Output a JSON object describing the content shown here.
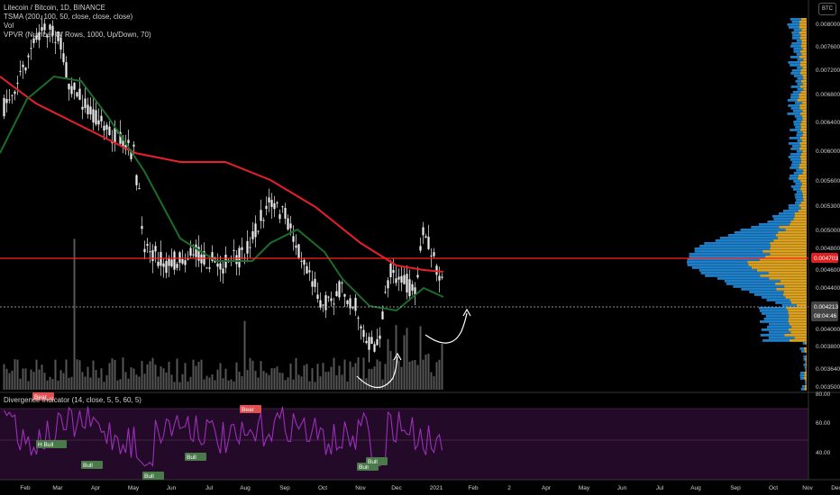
{
  "legend": {
    "title": "Litecoin / Bitcoin, 1D, BINANCE",
    "tsma": "TSMA (200, 100, 50, close, close, close)",
    "vol": "Vol",
    "vpvr": "VPVR (Number Of Rows, 1000, Up/Down, 70)",
    "divergence": "Divergence Indicator (14, close, 5, 5, 60, 5)"
  },
  "currency_badge": "BTC",
  "colors": {
    "up": "#e8e8e8",
    "down": "#e8e8e8",
    "ma200": "#e8202a",
    "ma100": "#1b6e2a",
    "rsi": "#9b2fb8",
    "vpvr_up": "#1e7fc8",
    "vpvr_down": "#d9a021",
    "hline": "#ff2020",
    "rsi_band": "#2a0a30"
  },
  "chart_data": [
    {
      "type": "candlestick",
      "title": "Litecoin / Bitcoin, 1D, BINANCE",
      "price_ticks": [
        "0.008000",
        "0.007600",
        "0.007200",
        "0.006800",
        "0.006400",
        "0.006000",
        "0.005600",
        "0.005300",
        "0.005000",
        "0.004800",
        "0.004600",
        "0.004400",
        "0.004000",
        "0.003800",
        "0.003640",
        "0.003500"
      ],
      "current_price": "0.004213",
      "current_countdown": "08:04:46",
      "hline_price": "0.004703",
      "x_ticks": [
        "Feb",
        "Mar",
        "Apr",
        "May",
        "Jun",
        "Jul",
        "Aug",
        "Sep",
        "Oct",
        "Nov",
        "Dec",
        "2021",
        "Feb",
        "2",
        "Apr",
        "May",
        "Jun",
        "Jul",
        "Aug",
        "Sep",
        "Oct",
        "Nov",
        "Dec"
      ],
      "series": [
        {
          "name": "TSMA 200"
        },
        {
          "name": "TSMA 100"
        }
      ]
    },
    {
      "type": "line",
      "title": "Divergence Indicator (14, close, 5, 5, 60, 5)",
      "y_ticks": [
        "80.00",
        "60.00",
        "40.00"
      ],
      "labels": [
        {
          "text": "Bear",
          "x_index": 12,
          "value": 78
        },
        {
          "text": "H Bull",
          "x_index": 14,
          "value": 52
        },
        {
          "text": "Bull",
          "x_index": 30,
          "value": 39
        },
        {
          "text": "Bull",
          "x_index": 68,
          "value": 27
        },
        {
          "text": "Bull",
          "x_index": 73,
          "value": 42
        },
        {
          "text": "Bear",
          "x_index": 96,
          "value": 74
        },
        {
          "text": "Bull",
          "x_index": 140,
          "value": 37
        },
        {
          "text": "Bull",
          "x_index": 143,
          "value": 41
        }
      ]
    }
  ]
}
